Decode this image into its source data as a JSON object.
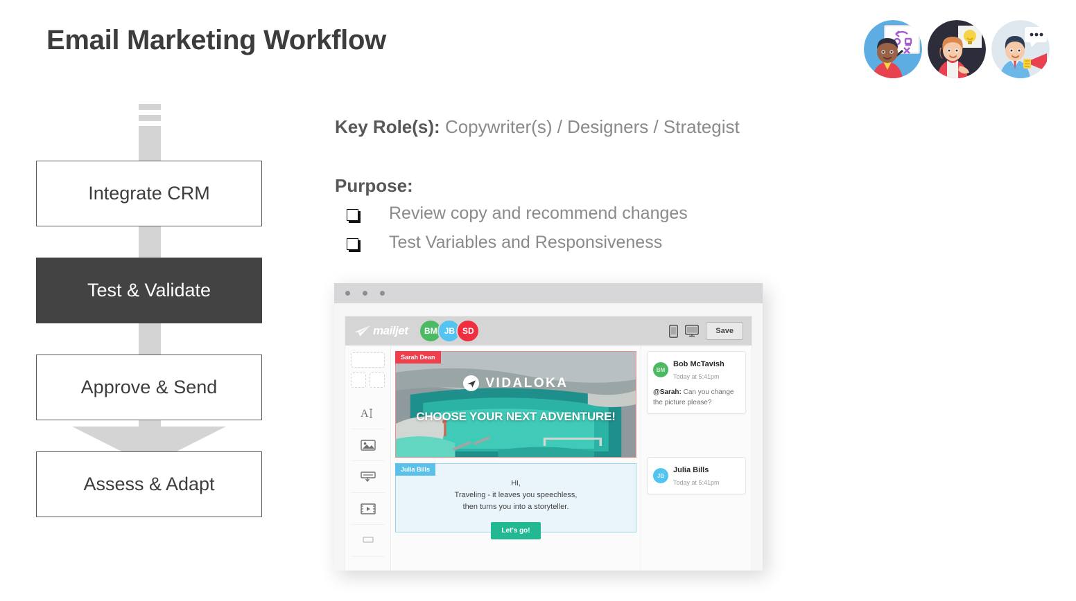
{
  "header": {
    "title": "Email Marketing Workflow",
    "avatars": [
      {
        "name": "strategist-whiteboard-avatar"
      },
      {
        "name": "idea-lightbulb-avatar"
      },
      {
        "name": "megaphone-announcer-avatar"
      }
    ]
  },
  "flow": {
    "steps": [
      {
        "label": "Integrate CRM",
        "active": false
      },
      {
        "label": "Test & Validate",
        "active": true
      },
      {
        "label": "Approve & Send",
        "active": false
      },
      {
        "label": "Assess & Adapt",
        "active": false
      }
    ],
    "arrow_color": "#d4d4d4",
    "active_color": "#434343"
  },
  "details": {
    "roles_label": "Key Role(s):",
    "roles_value": "Copywriter(s) / Designers / Strategist",
    "purpose_label": "Purpose:",
    "purpose_items": [
      "Review copy and recommend changes",
      "Test Variables and Responsiveness"
    ]
  },
  "mock": {
    "window_dots": 3,
    "app": {
      "logo_text": "mailjet",
      "avatars": [
        {
          "initials": "BM",
          "color": "#4cb963"
        },
        {
          "initials": "JB",
          "color": "#53c4ef"
        },
        {
          "initials": "SD",
          "color": "#ef2e3f"
        }
      ],
      "save_label": "Save",
      "sidebar_tools": [
        "text-tool",
        "image-tool",
        "button-tool",
        "video-tool"
      ],
      "email": {
        "hero": {
          "tag": "Sarah Dean",
          "tag_color": "#ef3f4d",
          "brand": "VIDALOKA",
          "headline": "CHOOSE YOUR NEXT ADVENTURE!"
        },
        "copy": {
          "tag": "Julia Bills",
          "tag_color": "#5bc0ea",
          "lines": [
            "Hi,",
            "Traveling - it leaves you speechless,",
            "then turns you into a storyteller."
          ],
          "cta": "Let's go!",
          "cta_color": "#21b892"
        }
      },
      "comments": [
        {
          "initials": "BM",
          "color": "#4cb963",
          "name": "Bob McTavish",
          "time": "Today at 5:41pm",
          "mention": "@Sarah:",
          "text": " Can you change the picture please?"
        },
        {
          "initials": "JB",
          "color": "#53c4ef",
          "name": "Julia Bills",
          "time": "Today at 5:41pm",
          "mention": "",
          "text": ""
        }
      ]
    }
  }
}
